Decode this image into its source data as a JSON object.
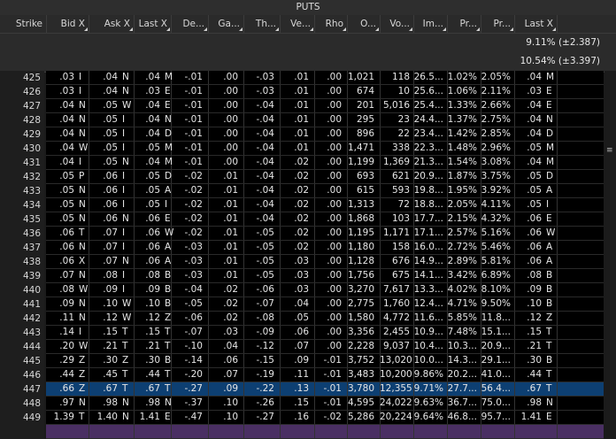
{
  "section_title": "PUTS",
  "columns": [
    "Strike",
    "Bid X",
    "Ask X",
    "Last X",
    "De...",
    "Ga...",
    "Th...",
    "Ve...",
    "Rho",
    "O...",
    "Vo...",
    "Im...",
    "Pr...",
    "Pr...",
    "Last X"
  ],
  "summary": [
    "9.11% (±2.387)",
    "10.54% (±3.397)"
  ],
  "selected_strike": "447",
  "rows": [
    {
      "strike": "425",
      "bid": ".03",
      "bx": "I",
      "ask": ".04",
      "ax": "N",
      "last": ".04",
      "lx": "M",
      "delta": "-.01",
      "gamma": ".00",
      "theta": "-.03",
      "vega": ".01",
      "rho": ".00",
      "oi": "1,021",
      "vol": "118",
      "iv": "26.5...",
      "pr1": "1.02%",
      "pr2": "2.05%",
      "last2": ".04",
      "l2x": "M"
    },
    {
      "strike": "426",
      "bid": ".03",
      "bx": "I",
      "ask": ".04",
      "ax": "N",
      "last": ".03",
      "lx": "E",
      "delta": "-.01",
      "gamma": ".00",
      "theta": "-.03",
      "vega": ".01",
      "rho": ".00",
      "oi": "674",
      "vol": "10",
      "iv": "25.6...",
      "pr1": "1.06%",
      "pr2": "2.11%",
      "last2": ".03",
      "l2x": "E"
    },
    {
      "strike": "427",
      "bid": ".04",
      "bx": "N",
      "ask": ".05",
      "ax": "W",
      "last": ".04",
      "lx": "E",
      "delta": "-.01",
      "gamma": ".00",
      "theta": "-.04",
      "vega": ".01",
      "rho": ".00",
      "oi": "201",
      "vol": "5,016",
      "iv": "25.4...",
      "pr1": "1.33%",
      "pr2": "2.66%",
      "last2": ".04",
      "l2x": "E"
    },
    {
      "strike": "428",
      "bid": ".04",
      "bx": "N",
      "ask": ".05",
      "ax": "I",
      "last": ".04",
      "lx": "N",
      "delta": "-.01",
      "gamma": ".00",
      "theta": "-.04",
      "vega": ".01",
      "rho": ".00",
      "oi": "295",
      "vol": "23",
      "iv": "24.4...",
      "pr1": "1.37%",
      "pr2": "2.75%",
      "last2": ".04",
      "l2x": "N"
    },
    {
      "strike": "429",
      "bid": ".04",
      "bx": "N",
      "ask": ".05",
      "ax": "I",
      "last": ".04",
      "lx": "D",
      "delta": "-.01",
      "gamma": ".00",
      "theta": "-.04",
      "vega": ".01",
      "rho": ".00",
      "oi": "896",
      "vol": "22",
      "iv": "23.4...",
      "pr1": "1.42%",
      "pr2": "2.85%",
      "last2": ".04",
      "l2x": "D"
    },
    {
      "strike": "430",
      "bid": ".04",
      "bx": "W",
      "ask": ".05",
      "ax": "I",
      "last": ".05",
      "lx": "M",
      "delta": "-.01",
      "gamma": ".00",
      "theta": "-.04",
      "vega": ".01",
      "rho": ".00",
      "oi": "1,471",
      "vol": "338",
      "iv": "22.3...",
      "pr1": "1.48%",
      "pr2": "2.96%",
      "last2": ".05",
      "l2x": "M"
    },
    {
      "strike": "431",
      "bid": ".04",
      "bx": "I",
      "ask": ".05",
      "ax": "N",
      "last": ".04",
      "lx": "M",
      "delta": "-.01",
      "gamma": ".00",
      "theta": "-.04",
      "vega": ".02",
      "rho": ".00",
      "oi": "1,199",
      "vol": "1,369",
      "iv": "21.3...",
      "pr1": "1.54%",
      "pr2": "3.08%",
      "last2": ".04",
      "l2x": "M"
    },
    {
      "strike": "432",
      "bid": ".05",
      "bx": "P",
      "ask": ".06",
      "ax": "I",
      "last": ".05",
      "lx": "D",
      "delta": "-.02",
      "gamma": ".01",
      "theta": "-.04",
      "vega": ".02",
      "rho": ".00",
      "oi": "693",
      "vol": "621",
      "iv": "20.9...",
      "pr1": "1.87%",
      "pr2": "3.75%",
      "last2": ".05",
      "l2x": "D"
    },
    {
      "strike": "433",
      "bid": ".05",
      "bx": "N",
      "ask": ".06",
      "ax": "I",
      "last": ".05",
      "lx": "A",
      "delta": "-.02",
      "gamma": ".01",
      "theta": "-.04",
      "vega": ".02",
      "rho": ".00",
      "oi": "615",
      "vol": "593",
      "iv": "19.8...",
      "pr1": "1.95%",
      "pr2": "3.92%",
      "last2": ".05",
      "l2x": "A"
    },
    {
      "strike": "434",
      "bid": ".05",
      "bx": "N",
      "ask": ".06",
      "ax": "I",
      "last": ".05",
      "lx": "I",
      "delta": "-.02",
      "gamma": ".01",
      "theta": "-.04",
      "vega": ".02",
      "rho": ".00",
      "oi": "1,313",
      "vol": "72",
      "iv": "18.8...",
      "pr1": "2.05%",
      "pr2": "4.11%",
      "last2": ".05",
      "l2x": "I"
    },
    {
      "strike": "435",
      "bid": ".05",
      "bx": "N",
      "ask": ".06",
      "ax": "N",
      "last": ".06",
      "lx": "E",
      "delta": "-.02",
      "gamma": ".01",
      "theta": "-.04",
      "vega": ".02",
      "rho": ".00",
      "oi": "1,868",
      "vol": "103",
      "iv": "17.7...",
      "pr1": "2.15%",
      "pr2": "4.32%",
      "last2": ".06",
      "l2x": "E"
    },
    {
      "strike": "436",
      "bid": ".06",
      "bx": "T",
      "ask": ".07",
      "ax": "I",
      "last": ".06",
      "lx": "W",
      "delta": "-.02",
      "gamma": ".01",
      "theta": "-.05",
      "vega": ".02",
      "rho": ".00",
      "oi": "1,195",
      "vol": "1,171",
      "iv": "17.1...",
      "pr1": "2.57%",
      "pr2": "5.16%",
      "last2": ".06",
      "l2x": "W"
    },
    {
      "strike": "437",
      "bid": ".06",
      "bx": "N",
      "ask": ".07",
      "ax": "I",
      "last": ".06",
      "lx": "A",
      "delta": "-.03",
      "gamma": ".01",
      "theta": "-.05",
      "vega": ".02",
      "rho": ".00",
      "oi": "1,180",
      "vol": "158",
      "iv": "16.0...",
      "pr1": "2.72%",
      "pr2": "5.46%",
      "last2": ".06",
      "l2x": "A"
    },
    {
      "strike": "438",
      "bid": ".06",
      "bx": "X",
      "ask": ".07",
      "ax": "N",
      "last": ".06",
      "lx": "A",
      "delta": "-.03",
      "gamma": ".01",
      "theta": "-.05",
      "vega": ".03",
      "rho": ".00",
      "oi": "1,128",
      "vol": "676",
      "iv": "14.9...",
      "pr1": "2.89%",
      "pr2": "5.81%",
      "last2": ".06",
      "l2x": "A"
    },
    {
      "strike": "439",
      "bid": ".07",
      "bx": "N",
      "ask": ".08",
      "ax": "I",
      "last": ".08",
      "lx": "B",
      "delta": "-.03",
      "gamma": ".01",
      "theta": "-.05",
      "vega": ".03",
      "rho": ".00",
      "oi": "1,756",
      "vol": "675",
      "iv": "14.1...",
      "pr1": "3.42%",
      "pr2": "6.89%",
      "last2": ".08",
      "l2x": "B"
    },
    {
      "strike": "440",
      "bid": ".08",
      "bx": "W",
      "ask": ".09",
      "ax": "I",
      "last": ".09",
      "lx": "B",
      "delta": "-.04",
      "gamma": ".02",
      "theta": "-.06",
      "vega": ".03",
      "rho": ".00",
      "oi": "3,270",
      "vol": "7,617",
      "iv": "13.3...",
      "pr1": "4.02%",
      "pr2": "8.10%",
      "last2": ".09",
      "l2x": "B"
    },
    {
      "strike": "441",
      "bid": ".09",
      "bx": "N",
      "ask": ".10",
      "ax": "W",
      "last": ".10",
      "lx": "B",
      "delta": "-.05",
      "gamma": ".02",
      "theta": "-.07",
      "vega": ".04",
      "rho": ".00",
      "oi": "2,775",
      "vol": "1,760",
      "iv": "12.4...",
      "pr1": "4.71%",
      "pr2": "9.50%",
      "last2": ".10",
      "l2x": "B"
    },
    {
      "strike": "442",
      "bid": ".11",
      "bx": "N",
      "ask": ".12",
      "ax": "W",
      "last": ".12",
      "lx": "Z",
      "delta": "-.06",
      "gamma": ".02",
      "theta": "-.08",
      "vega": ".05",
      "rho": ".00",
      "oi": "1,580",
      "vol": "4,772",
      "iv": "11.6...",
      "pr1": "5.85%",
      "pr2": "11.8...",
      "last2": ".12",
      "l2x": "Z"
    },
    {
      "strike": "443",
      "bid": ".14",
      "bx": "I",
      "ask": ".15",
      "ax": "T",
      "last": ".15",
      "lx": "T",
      "delta": "-.07",
      "gamma": ".03",
      "theta": "-.09",
      "vega": ".06",
      "rho": ".00",
      "oi": "3,356",
      "vol": "2,455",
      "iv": "10.9...",
      "pr1": "7.48%",
      "pr2": "15.1...",
      "last2": ".15",
      "l2x": "T"
    },
    {
      "strike": "444",
      "bid": ".20",
      "bx": "W",
      "ask": ".21",
      "ax": "T",
      "last": ".21",
      "lx": "T",
      "delta": "-.10",
      "gamma": ".04",
      "theta": "-.12",
      "vega": ".07",
      "rho": ".00",
      "oi": "2,228",
      "vol": "9,037",
      "iv": "10.4...",
      "pr1": "10.3...",
      "pr2": "20.9...",
      "last2": ".21",
      "l2x": "T"
    },
    {
      "strike": "445",
      "bid": ".29",
      "bx": "Z",
      "ask": ".30",
      "ax": "Z",
      "last": ".30",
      "lx": "B",
      "delta": "-.14",
      "gamma": ".06",
      "theta": "-.15",
      "vega": ".09",
      "rho": "-.01",
      "oi": "3,752",
      "vol": "13,020",
      "iv": "10.0...",
      "pr1": "14.3...",
      "pr2": "29.1...",
      "last2": ".30",
      "l2x": "B"
    },
    {
      "strike": "446",
      "bid": ".44",
      "bx": "Z",
      "ask": ".45",
      "ax": "T",
      "last": ".44",
      "lx": "T",
      "delta": "-.20",
      "gamma": ".07",
      "theta": "-.19",
      "vega": ".11",
      "rho": "-.01",
      "oi": "3,483",
      "vol": "10,200",
      "iv": "9.86%",
      "pr1": "20.2...",
      "pr2": "41.0...",
      "last2": ".44",
      "l2x": "T"
    },
    {
      "strike": "447",
      "bid": ".66",
      "bx": "Z",
      "ask": ".67",
      "ax": "T",
      "last": ".67",
      "lx": "T",
      "delta": "-.27",
      "gamma": ".09",
      "theta": "-.22",
      "vega": ".13",
      "rho": "-.01",
      "oi": "3,780",
      "vol": "12,355",
      "iv": "9.71%",
      "pr1": "27.7...",
      "pr2": "56.4...",
      "last2": ".67",
      "l2x": "T"
    },
    {
      "strike": "448",
      "bid": ".97",
      "bx": "N",
      "ask": ".98",
      "ax": "N",
      "last": ".98",
      "lx": "N",
      "delta": "-.37",
      "gamma": ".10",
      "theta": "-.26",
      "vega": ".15",
      "rho": "-.01",
      "oi": "4,595",
      "vol": "24,022",
      "iv": "9.63%",
      "pr1": "36.7...",
      "pr2": "75.0...",
      "last2": ".98",
      "l2x": "N"
    },
    {
      "strike": "449",
      "bid": "1.39",
      "bx": "T",
      "ask": "1.40",
      "ax": "N",
      "last": "1.41",
      "lx": "E",
      "delta": "-.47",
      "gamma": ".10",
      "theta": "-.27",
      "vega": ".16",
      "rho": "-.02",
      "oi": "5,286",
      "vol": "20,224",
      "iv": "9.64%",
      "pr1": "46.8...",
      "pr2": "95.7...",
      "last2": "1.41",
      "l2x": "E"
    }
  ]
}
